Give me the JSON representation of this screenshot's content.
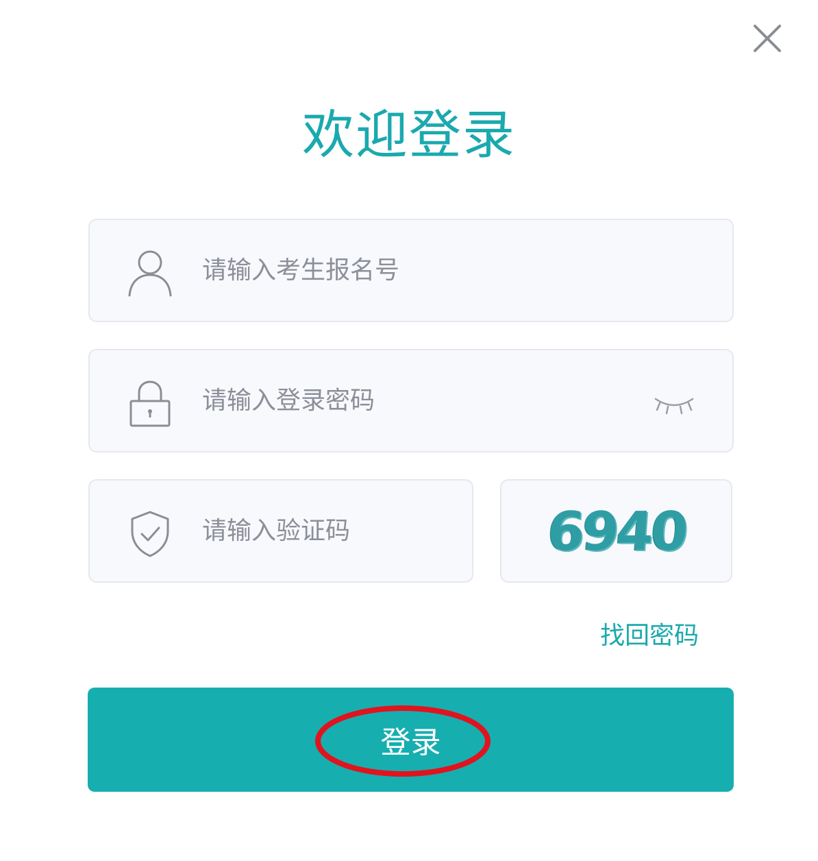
{
  "dialog": {
    "title": "欢迎登录",
    "close_icon": "close-icon"
  },
  "form": {
    "username": {
      "placeholder": "请输入考生报名号",
      "value": "",
      "icon": "user-icon"
    },
    "password": {
      "placeholder": "请输入登录密码",
      "value": "",
      "icon": "lock-icon",
      "toggle_icon": "eye-closed-icon"
    },
    "captcha": {
      "placeholder": "请输入验证码",
      "value": "",
      "icon": "shield-check-icon",
      "image_text": "6940"
    },
    "forgot_password_label": "找回密码",
    "submit_label": "登录"
  },
  "colors": {
    "accent": "#17aeb0",
    "title": "#1aa9ae",
    "field_bg": "#f8f9fd",
    "field_border": "#e6e8ef",
    "annotation_ring": "#e0141e"
  }
}
